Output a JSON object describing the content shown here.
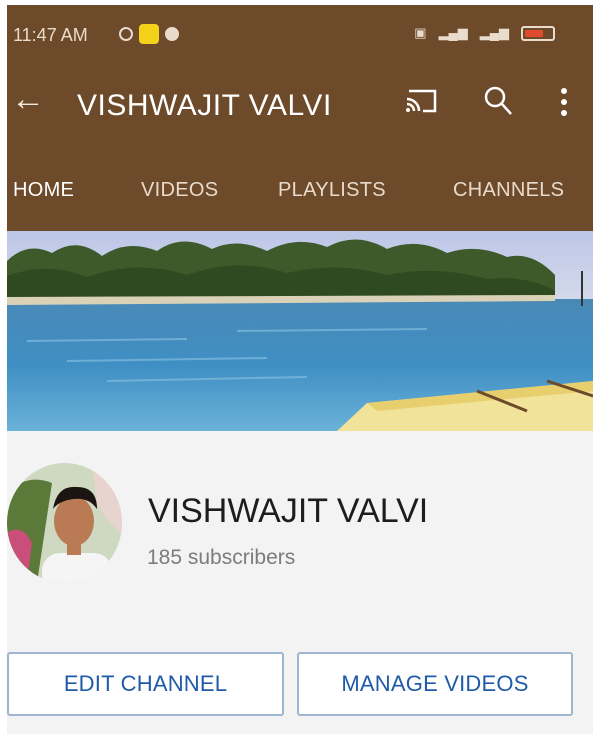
{
  "status_bar": {
    "time": "11:47 AM",
    "icons": [
      "alarm-icon",
      "snapchat-icon",
      "messenger-icon",
      "data-icon",
      "signal-icon",
      "signal-icon",
      "battery-icon"
    ],
    "battery_color": "#e04a2e"
  },
  "app_bar": {
    "title": "VISHWAJIT VALVI",
    "background": "#6d4a2a",
    "icons": [
      "back-arrow-icon",
      "cast-icon",
      "search-icon",
      "more-vert-icon"
    ]
  },
  "tabs": [
    {
      "label": "HOME",
      "active": true
    },
    {
      "label": "VIDEOS",
      "active": false
    },
    {
      "label": "PLAYLISTS",
      "active": false
    },
    {
      "label": "CHANNELS",
      "active": false
    }
  ],
  "channel": {
    "name": "VISHWAJIT VALVI",
    "subscribers": "185 subscribers"
  },
  "actions": {
    "edit_label": "EDIT CHANNEL",
    "manage_label": "MANAGE VIDEOS",
    "accent": "#1f5ba8"
  }
}
